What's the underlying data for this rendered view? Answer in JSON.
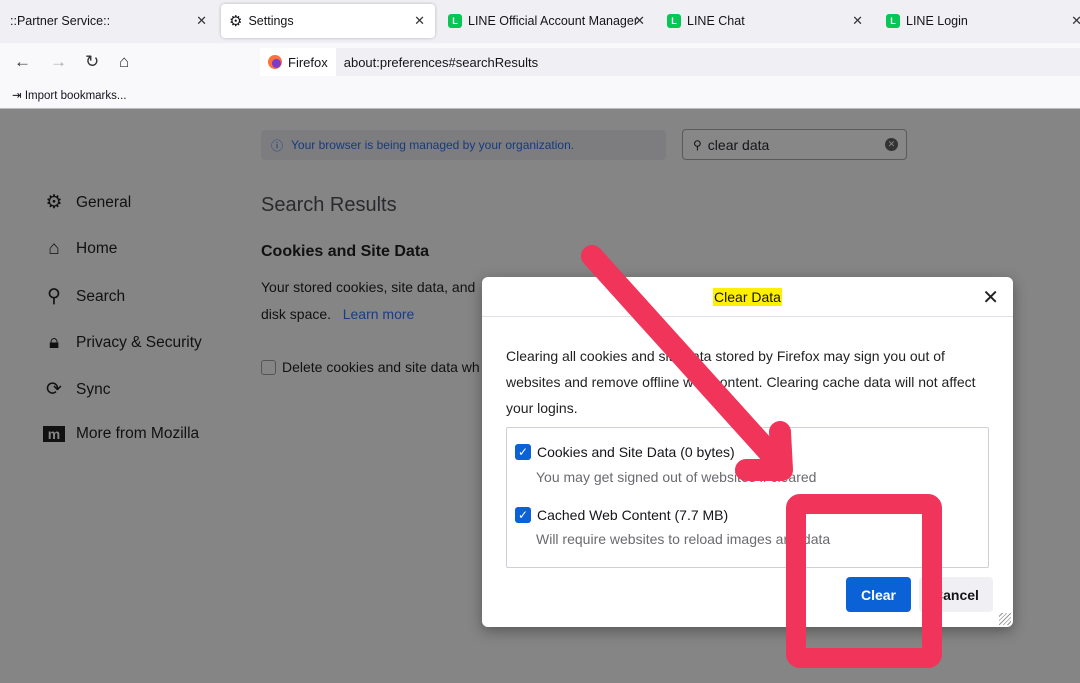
{
  "tabs": [
    {
      "label": "::Partner Service::",
      "icon": "none"
    },
    {
      "label": "Settings",
      "icon": "gear-icon",
      "active": true
    },
    {
      "label": "LINE Official Account Manager",
      "icon": "line-shield-icon"
    },
    {
      "label": "LINE Chat",
      "icon": "line-shield-icon"
    },
    {
      "label": "LINE Login",
      "icon": "line-chat-icon"
    }
  ],
  "nav": {
    "identity": "Firefox",
    "url": "about:preferences#searchResults",
    "import_bookmarks": "Import bookmarks..."
  },
  "managed_notice": "Your browser is being managed by your organization.",
  "search": {
    "value": "clear data"
  },
  "sidebar": [
    {
      "label": "General",
      "icon": "gear-icon"
    },
    {
      "label": "Home",
      "icon": "home-icon"
    },
    {
      "label": "Search",
      "icon": "search-icon"
    },
    {
      "label": "Privacy & Security",
      "icon": "lock-icon"
    },
    {
      "label": "Sync",
      "icon": "sync-icon"
    },
    {
      "label": "More from Mozilla",
      "icon": "mozilla-icon"
    }
  ],
  "content": {
    "heading": "Search Results",
    "section": "Cookies and Site Data",
    "text1": "Your stored cookies, site data, and",
    "text2": "disk space.",
    "learn_more": "Learn more",
    "delete_checkbox": "Delete cookies and site data wh"
  },
  "dialog": {
    "title": "Clear Data",
    "description": "Clearing all cookies and site data stored by Firefox may sign you out of websites and remove offline web content. Clearing cache data will not affect your logins.",
    "options": [
      {
        "label": "Cookies and Site Data (0 bytes)",
        "sub": "You may get signed out of websites if cleared",
        "checked": true
      },
      {
        "label": "Cached Web Content (7.7 MB)",
        "sub": "Will require websites to reload images and data",
        "checked": true
      }
    ],
    "clear": "Clear",
    "cancel": "Cancel"
  },
  "colors": {
    "annotation": "#f0345a",
    "primary": "#0b61d6",
    "highlight": "#ffef00"
  }
}
